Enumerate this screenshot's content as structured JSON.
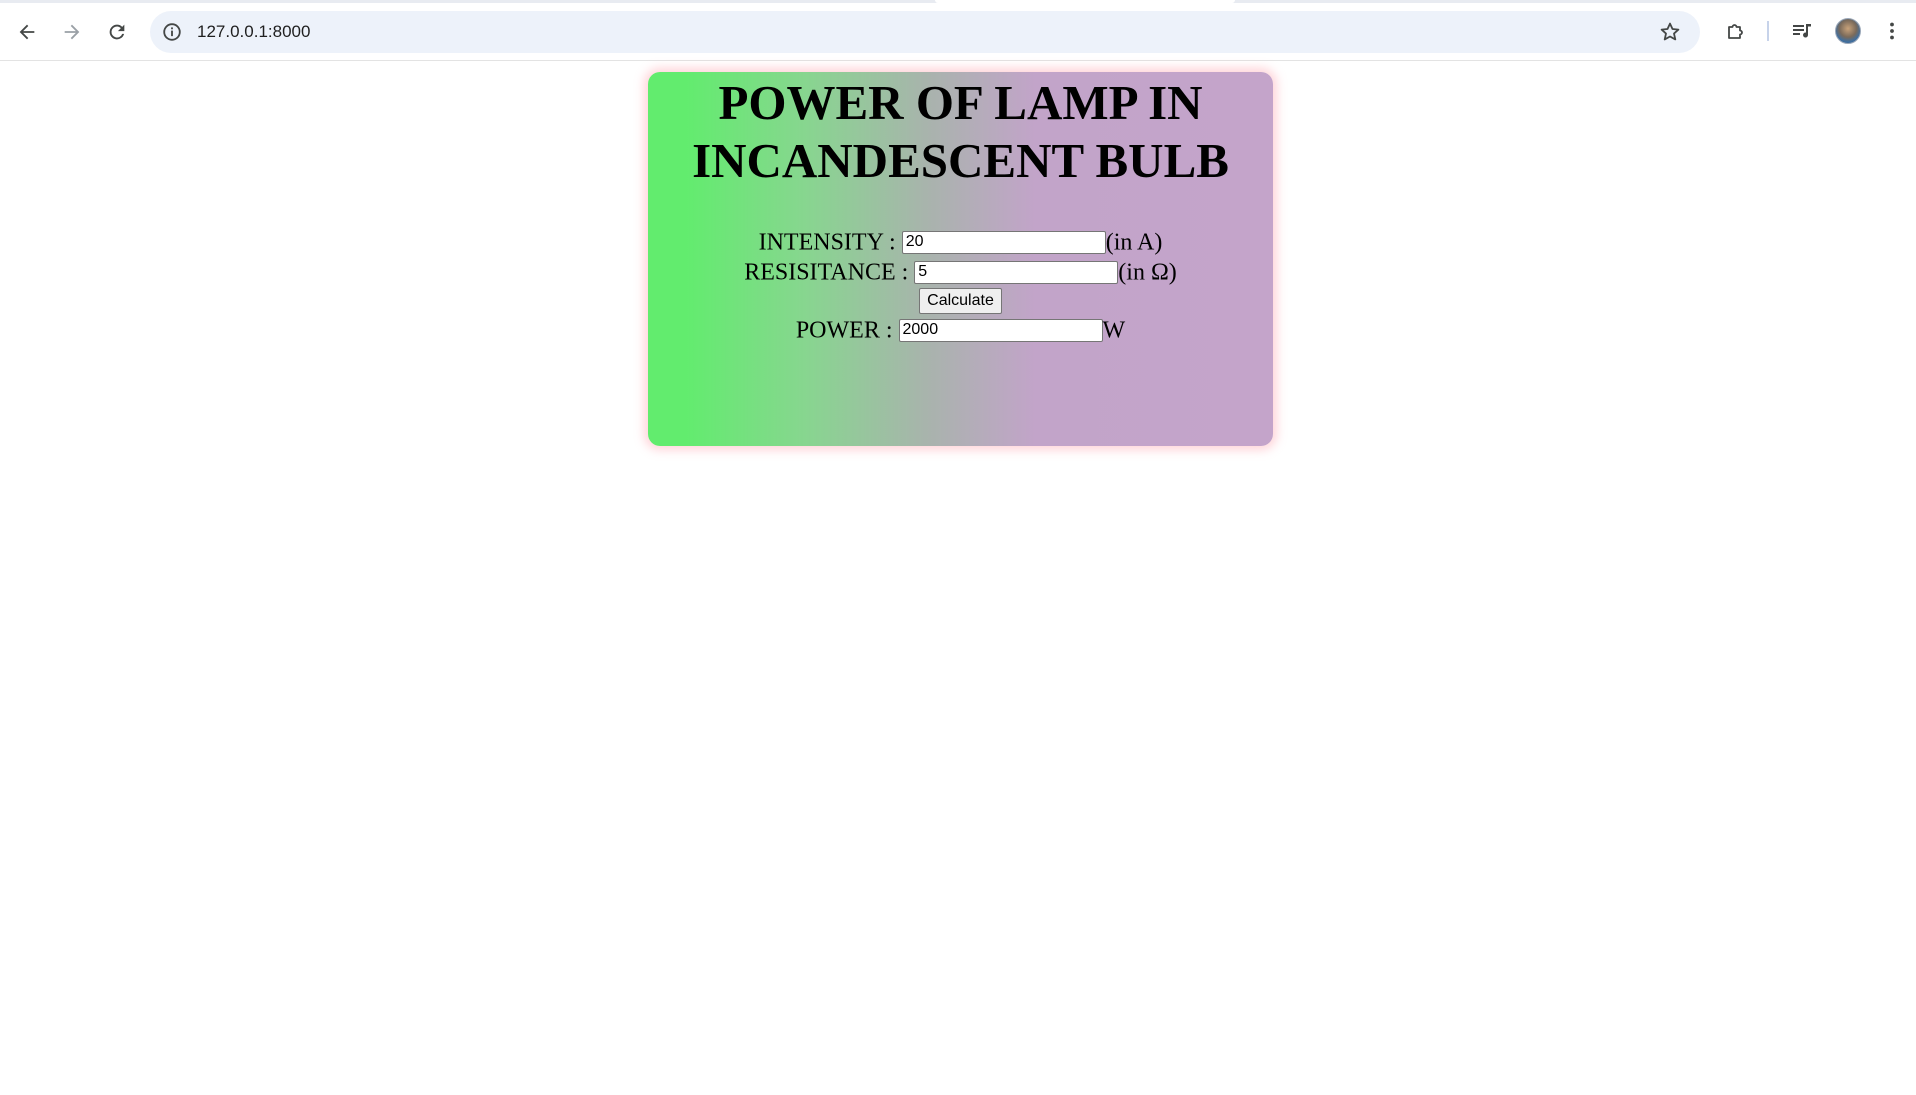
{
  "browser": {
    "url": "127.0.0.1:8000",
    "icons": {
      "back": "arrow-left-icon",
      "forward": "arrow-right-icon",
      "reload": "reload-icon",
      "site_info": "info-icon",
      "bookmark": "star-icon",
      "extensions": "puzzle-icon",
      "media": "media-controls-icon",
      "profile": "avatar",
      "menu": "kebab-menu-icon"
    }
  },
  "card": {
    "title_line1": "POWER OF LAMP IN",
    "title_line2": "INCANDESCENT BULB",
    "gradient_colors": [
      "#62ec6e",
      "#c4a4ca"
    ],
    "shadow_color": "#ffa0aa"
  },
  "form": {
    "intensity": {
      "label": "INTENSITY :",
      "value": "20",
      "unit": "(in A)"
    },
    "resistance": {
      "label": "RESISITANCE :",
      "value": "5",
      "unit": "(in Ω)"
    },
    "calculate_label": "Calculate",
    "power": {
      "label": "POWER :",
      "value": "2000",
      "unit": "W"
    }
  }
}
